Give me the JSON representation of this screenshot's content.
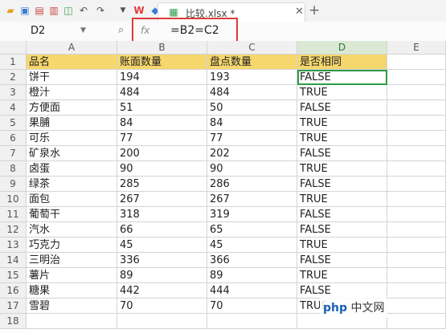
{
  "tab": {
    "filename": "比较.xlsx *"
  },
  "formula_bar": {
    "cell_ref": "D2",
    "fx": "fx",
    "formula": "=B2=C2"
  },
  "columns": [
    "A",
    "B",
    "C",
    "D",
    "E"
  ],
  "rows": [
    [
      "品名",
      "账面数量",
      "盘点数量",
      "是否相同"
    ],
    [
      "饼干",
      "194",
      "193",
      "FALSE"
    ],
    [
      "橙汁",
      "484",
      "484",
      "TRUE"
    ],
    [
      "方便面",
      "51",
      "50",
      "FALSE"
    ],
    [
      "果脯",
      "84",
      "84",
      "TRUE"
    ],
    [
      "可乐",
      "77",
      "77",
      "TRUE"
    ],
    [
      "矿泉水",
      "200",
      "202",
      "FALSE"
    ],
    [
      "卤蛋",
      "90",
      "90",
      "TRUE"
    ],
    [
      "绿茶",
      "285",
      "286",
      "FALSE"
    ],
    [
      "面包",
      "267",
      "267",
      "TRUE"
    ],
    [
      "葡萄干",
      "318",
      "319",
      "FALSE"
    ],
    [
      "汽水",
      "66",
      "65",
      "FALSE"
    ],
    [
      "巧克力",
      "45",
      "45",
      "TRUE"
    ],
    [
      "三明治",
      "336",
      "366",
      "FALSE"
    ],
    [
      "薯片",
      "89",
      "89",
      "TRUE"
    ],
    [
      "糖果",
      "442",
      "444",
      "FALSE"
    ],
    [
      "雪碧",
      "70",
      "70",
      "TRUE"
    ],
    [
      "",
      "",
      "",
      ""
    ]
  ],
  "watermark": {
    "brand": "php",
    "text": "中文网"
  },
  "colors": {
    "header_fill": "#f5d76e",
    "selection": "#2e9a47",
    "highlight_box": "#e03a3a"
  }
}
